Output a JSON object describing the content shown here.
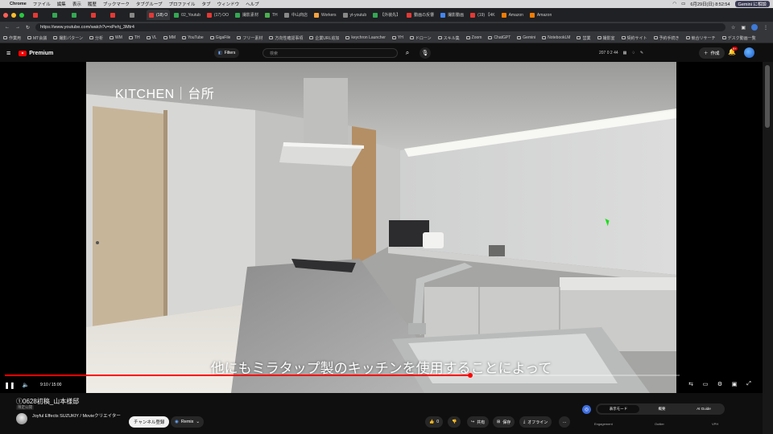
{
  "menubar": {
    "app": "Chrome",
    "items": [
      "ファイル",
      "編集",
      "表示",
      "履歴",
      "ブックマーク",
      "タブグループ",
      "プロファイル",
      "タブ",
      "ウィンドウ",
      "ヘルプ"
    ],
    "clock": "6月29日(日) 8:52:54",
    "gemini": "Gemini に相談"
  },
  "tabs": [
    {
      "label": "",
      "color": "#e53935"
    },
    {
      "label": "",
      "color": "#34a853"
    },
    {
      "label": "",
      "color": "#34a853"
    },
    {
      "label": "",
      "color": "#e53935"
    },
    {
      "label": "",
      "color": "#e53935"
    },
    {
      "label": "",
      "color": "#888888"
    },
    {
      "label": "(18) O",
      "color": "#e53935"
    },
    {
      "label": "02_Youtub",
      "color": "#34a853"
    },
    {
      "label": "(17) OO",
      "color": "#e53935"
    },
    {
      "label": "撮影素材",
      "color": "#34a853"
    },
    {
      "label": "TH",
      "color": "#4caf50"
    },
    {
      "label": "中山商店",
      "color": "#888888"
    },
    {
      "label": "Workers",
      "color": "#f4a340"
    },
    {
      "label": "yt-youtub",
      "color": "#888888"
    },
    {
      "label": "【外装先】",
      "color": "#34a853"
    },
    {
      "label": "動画の反響",
      "color": "#e53935"
    },
    {
      "label": "撮影動画",
      "color": "#4285f4"
    },
    {
      "label": "(19) 【4K",
      "color": "#e53935"
    },
    {
      "label": "Amazon",
      "color": "#f57c00"
    },
    {
      "label": "Amazon",
      "color": "#f57c00"
    }
  ],
  "address": {
    "url": "https://www.youtube.com/watch?v=xPehj_3Mtr4"
  },
  "bookmarks": [
    "作業用",
    "MT会議",
    "撮影パターン",
    "分析",
    "WM",
    "TH",
    "VL",
    "MM",
    "YouTube",
    "GigaFile",
    "フリー素材",
    "方向性確認事項",
    "企業URL追加",
    "keychron Launcher",
    "YH",
    "ドローン",
    "スキル集",
    "Zoom",
    "ChatGPT",
    "Gemini",
    "NotebookLM",
    "営業",
    "撮影室",
    "契約サイト",
    "予約手続き",
    "競合リサーチ",
    "デスク動画一覧"
  ],
  "header": {
    "filters": "Filters",
    "search_placeholder": "検索",
    "stats": "207  0  2  44",
    "create": "作成",
    "notif": "9+"
  },
  "video": {
    "overlay_title": "KITCHEN｜台所",
    "subtitle": "他にもミラタップ製のキッチンを使用することによって",
    "time": "9:10 / 15:00",
    "progress": 0.69
  },
  "below": {
    "title": "①0628初稿_山本様邸",
    "badge": "限定公開",
    "channel": "Joyful Effects    SUZUKIY / Movieクリエイター",
    "subscribe": "チャンネル登録",
    "remix": "Remix",
    "like": "0",
    "share": "共有",
    "save": "保存",
    "offline": "オフライン",
    "more": "..."
  },
  "panel": {
    "tabs": [
      "表示モード",
      "概要",
      "AI Guide"
    ],
    "sub": [
      "Engagement",
      "Outlier",
      "VPH"
    ]
  }
}
